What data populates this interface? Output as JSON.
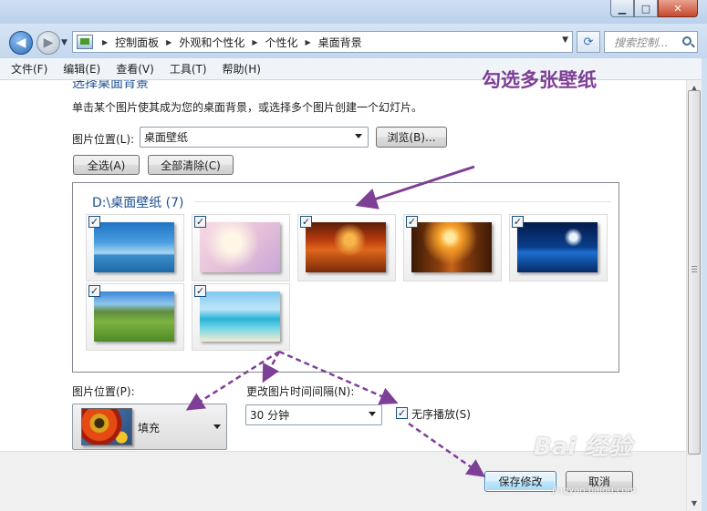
{
  "window": {
    "min_icon": "minimize-icon",
    "max_icon": "maximize-icon",
    "close_icon": "close-icon"
  },
  "address": {
    "crumbs": [
      "控制面板",
      "外观和个性化",
      "个性化",
      "桌面背景"
    ],
    "search_placeholder": "搜索控制..."
  },
  "menu": {
    "items": [
      "文件(F)",
      "编辑(E)",
      "查看(V)",
      "工具(T)",
      "帮助(H)"
    ]
  },
  "page": {
    "heading": "选择桌面背景",
    "description": "单击某个图片使其成为您的桌面背景，或选择多个图片创建一个幻灯片。",
    "location_label": "图片位置(L):",
    "location_value": "桌面壁纸",
    "browse_label": "浏览(B)...",
    "select_all_label": "全选(A)",
    "clear_all_label": "全部清除(C)",
    "group_title": "D:\\桌面壁纸 (7)",
    "thumbnails": [
      {
        "name": "sky-sea-wallpaper",
        "checked": true
      },
      {
        "name": "grass-pink-wallpaper",
        "checked": true
      },
      {
        "name": "autumn-park-wallpaper",
        "checked": true
      },
      {
        "name": "forest-sunlight-wallpaper",
        "checked": true
      },
      {
        "name": "night-water-wallpaper",
        "checked": true
      },
      {
        "name": "mountain-meadow-wallpaper",
        "checked": true
      },
      {
        "name": "tropical-beach-wallpaper",
        "checked": true
      }
    ],
    "position_label": "图片位置(P):",
    "position_value": "填充",
    "interval_label": "更改图片时间间隔(N):",
    "interval_value": "30 分钟",
    "shuffle_label": "无序播放(S)",
    "shuffle_checked": true,
    "save_label": "保存修改",
    "cancel_label": "取消"
  },
  "annotation": {
    "text": "勾选多张壁纸",
    "color": "#7e3f96"
  },
  "watermark": {
    "main": "Bai 经验",
    "sub": "jingyan.baidu.com"
  }
}
